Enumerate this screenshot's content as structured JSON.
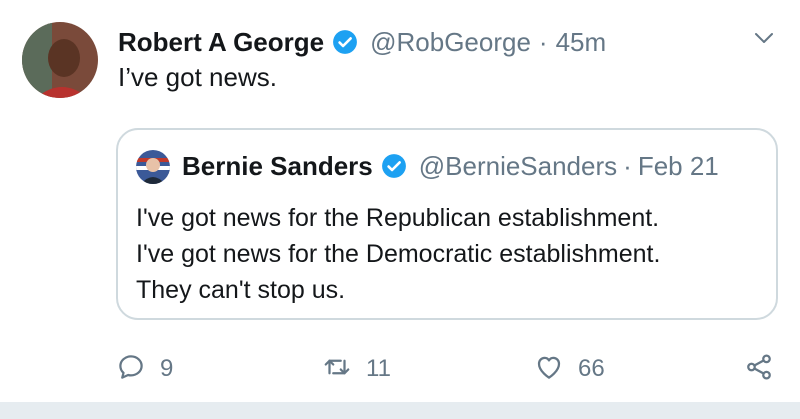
{
  "tweet": {
    "author": {
      "display_name": "Robert A George",
      "handle": "@RobGeorge",
      "separator": "·",
      "time": "45m",
      "verified": true
    },
    "text": "I’ve got news.",
    "quoted": {
      "display_name": "Bernie Sanders",
      "handle": "@BernieSanders",
      "separator": "·",
      "time": "Feb 21",
      "verified": true,
      "text": "I've got news for the Republican establishment.\nI've got news for the Democratic establishment.\nThey can't stop us."
    },
    "actions": {
      "replies": "9",
      "retweets": "11",
      "likes": "66"
    }
  },
  "colors": {
    "verified_blue": "#1DA1F2",
    "secondary_text": "#657786",
    "border": "#cfd9de"
  },
  "icons": [
    "verified-badge-icon",
    "chevron-down-icon",
    "reply-icon",
    "retweet-icon",
    "heart-icon",
    "share-icon"
  ]
}
